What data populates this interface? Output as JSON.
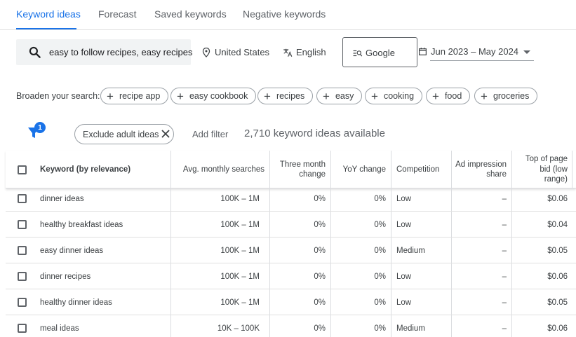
{
  "tabs": [
    {
      "label": "Keyword ideas",
      "active": true
    },
    {
      "label": "Forecast",
      "active": false
    },
    {
      "label": "Saved keywords",
      "active": false
    },
    {
      "label": "Negative keywords",
      "active": false
    }
  ],
  "search": {
    "value": "easy to follow recipes, easy recipes",
    "icon": "search-icon"
  },
  "location": {
    "label": "United States",
    "icon": "location-pin-icon"
  },
  "language": {
    "label": "English",
    "icon": "translate-icon"
  },
  "network": {
    "label": "Google",
    "icon": "search-network-icon"
  },
  "date_range": {
    "label": "Jun 2023 – May 2024",
    "icon": "calendar-icon"
  },
  "broaden": {
    "label": "Broaden your search:",
    "chips": [
      "recipe app",
      "easy cookbook",
      "recipes",
      "easy",
      "cooking",
      "food",
      "groceries"
    ]
  },
  "filters": {
    "badge_count": "1",
    "chip_label": "Exclude adult ideas",
    "add_filter_label": "Add filter",
    "summary": "2,710 keyword ideas available"
  },
  "table": {
    "columns": {
      "keyword": "Keyword (by relevance)",
      "avg": "Avg. monthly searches",
      "three_month_1": "Three month",
      "three_month_2": "change",
      "yoy": "YoY change",
      "competition": "Competition",
      "impression_1": "Ad impression",
      "impression_2": "share",
      "bid_1": "Top of page",
      "bid_2": "bid (low",
      "bid_3": "range)"
    },
    "rows": [
      {
        "keyword": "dinner ideas",
        "avg": "100K – 1M",
        "three": "0%",
        "yoy": "0%",
        "competition": "Low",
        "impression": "–",
        "bid": "$0.06"
      },
      {
        "keyword": "healthy breakfast ideas",
        "avg": "100K – 1M",
        "three": "0%",
        "yoy": "0%",
        "competition": "Low",
        "impression": "–",
        "bid": "$0.04"
      },
      {
        "keyword": "easy dinner ideas",
        "avg": "100K – 1M",
        "three": "0%",
        "yoy": "0%",
        "competition": "Medium",
        "impression": "–",
        "bid": "$0.05"
      },
      {
        "keyword": "dinner recipes",
        "avg": "100K – 1M",
        "three": "0%",
        "yoy": "0%",
        "competition": "Low",
        "impression": "–",
        "bid": "$0.06"
      },
      {
        "keyword": "healthy dinner ideas",
        "avg": "100K – 1M",
        "three": "0%",
        "yoy": "0%",
        "competition": "Low",
        "impression": "–",
        "bid": "$0.05"
      },
      {
        "keyword": "meal ideas",
        "avg": "10K – 100K",
        "three": "0%",
        "yoy": "0%",
        "competition": "Medium",
        "impression": "–",
        "bid": "$0.06"
      }
    ]
  },
  "colors": {
    "accent": "#1a73e8",
    "text": "#3c4043",
    "muted": "#5f6368",
    "border": "#dadce0"
  }
}
